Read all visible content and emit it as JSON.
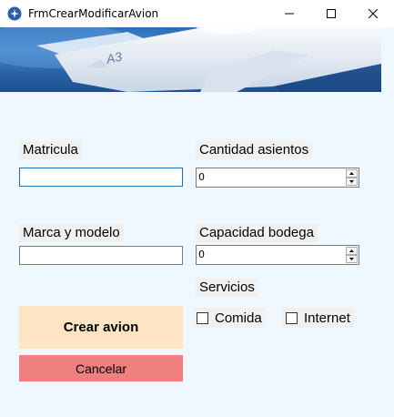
{
  "window": {
    "title": "FrmCrearModificarAvion"
  },
  "form": {
    "matricula": {
      "label": "Matricula",
      "value": ""
    },
    "marca_modelo": {
      "label": "Marca y modelo",
      "value": ""
    },
    "cantidad_asientos": {
      "label": "Cantidad asientos",
      "value": "0"
    },
    "capacidad_bodega": {
      "label": "Capacidad bodega",
      "value": "0"
    },
    "servicios": {
      "label": "Servicios",
      "comida": {
        "label": "Comida",
        "checked": false
      },
      "internet": {
        "label": "Internet",
        "checked": false
      }
    }
  },
  "buttons": {
    "crear_label": "Crear avion",
    "cancelar_label": "Cancelar"
  },
  "colors": {
    "background": "#f0f8ff",
    "crear_button": "#ffe4c4",
    "cancelar_button": "#f08080",
    "focus_border": "#1f6db3"
  }
}
